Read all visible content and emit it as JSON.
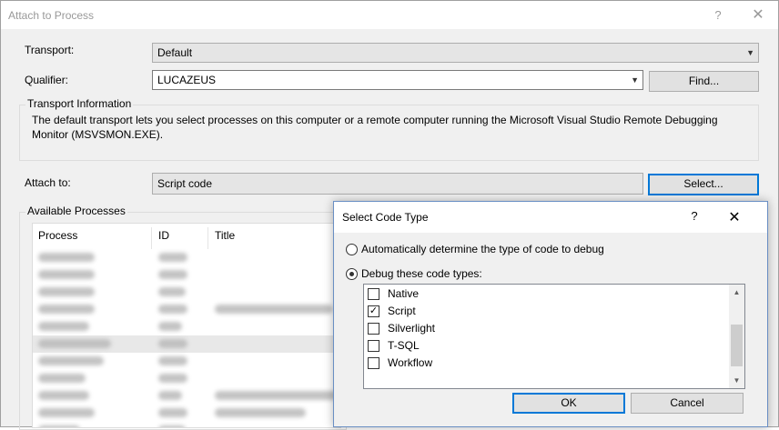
{
  "window": {
    "title": "Attach to Process",
    "help_glyph": "?",
    "close_glyph": "✕"
  },
  "transport": {
    "label": "Transport:",
    "value": "Default"
  },
  "qualifier": {
    "label": "Qualifier:",
    "value": "LUCAZEUS",
    "find_button": "Find..."
  },
  "transport_info": {
    "heading": "Transport Information",
    "text": "The default transport lets you select processes on this computer or a remote computer running the Microsoft Visual Studio Remote Debugging Monitor (MSVSMON.EXE)."
  },
  "attach_to": {
    "label": "Attach to:",
    "value": "Script code",
    "select_button": "Select..."
  },
  "available_processes": {
    "heading": "Available Processes",
    "columns": [
      "Process",
      "ID",
      "Title"
    ],
    "row_count_visible": 11,
    "selected_row": 5
  },
  "select_code_type": {
    "title": "Select Code Type",
    "help_glyph": "?",
    "close_glyph": "✕",
    "auto_option": "Automatically determine the type of code to debug",
    "manual_option": "Debug these code types:",
    "selected_option": "manual",
    "code_types": [
      {
        "label": "Native",
        "checked": false
      },
      {
        "label": "Script",
        "checked": true
      },
      {
        "label": "Silverlight",
        "checked": false
      },
      {
        "label": "T-SQL",
        "checked": false
      },
      {
        "label": "Workflow",
        "checked": false
      }
    ],
    "ok_button": "OK",
    "cancel_button": "Cancel"
  },
  "colors": {
    "accent": "#0078d7",
    "dialog_border": "#6a8fc4"
  }
}
